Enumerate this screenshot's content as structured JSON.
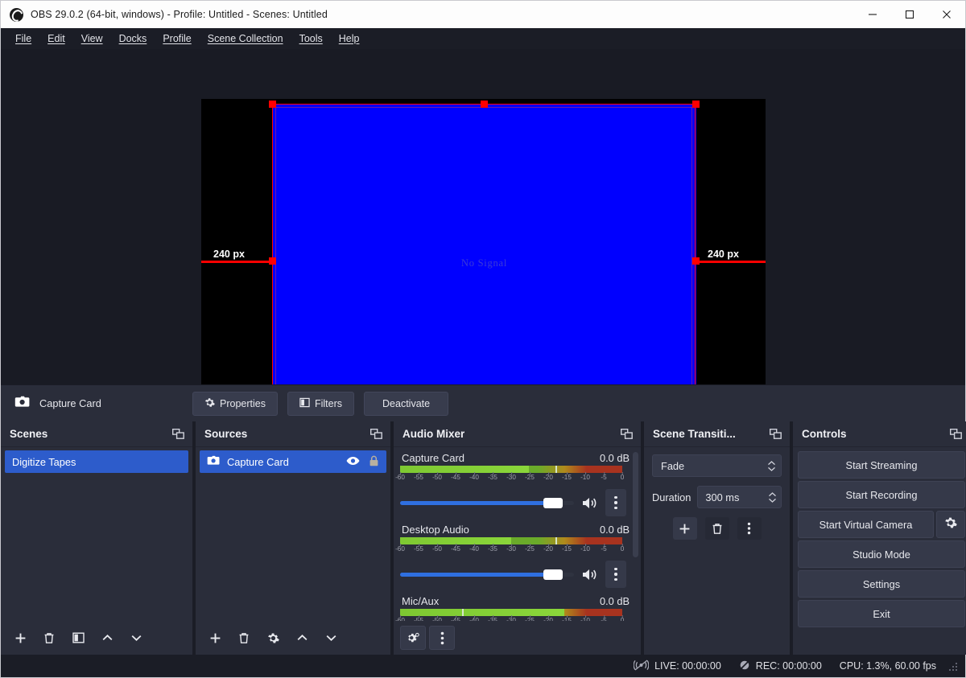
{
  "window": {
    "title": "OBS 29.0.2 (64-bit, windows) - Profile: Untitled - Scenes: Untitled",
    "logo_icon": "obs-logo-icon",
    "minimize_icon": "minimize-icon",
    "maximize_icon": "maximize-icon",
    "close_icon": "close-icon"
  },
  "menubar": {
    "items": [
      {
        "label": "File",
        "mnemonic": "F"
      },
      {
        "label": "Edit",
        "mnemonic": "E"
      },
      {
        "label": "View",
        "mnemonic": "V"
      },
      {
        "label": "Docks",
        "mnemonic": "D"
      },
      {
        "label": "Profile",
        "mnemonic": "P"
      },
      {
        "label": "Scene Collection",
        "mnemonic": "S"
      },
      {
        "label": "Tools",
        "mnemonic": "T"
      },
      {
        "label": "Help",
        "mnemonic": "H"
      }
    ]
  },
  "preview": {
    "no_signal_text": "No Signal",
    "guide_left_label": "240 px",
    "guide_right_label": "240 px",
    "selection_color": "#ff0000",
    "source_color": "#0000ff",
    "canvas_color": "#000000"
  },
  "source_toolbar": {
    "source_icon": "camera-icon",
    "source_name": "Capture Card",
    "properties_label": "Properties",
    "properties_icon": "gear-icon",
    "filters_label": "Filters",
    "filters_icon": "filters-icon",
    "deactivate_label": "Deactivate"
  },
  "scenes": {
    "title": "Scenes",
    "popout_icon": "popout-icon",
    "items": [
      {
        "label": "Digitize Tapes",
        "selected": true
      }
    ],
    "toolbar": [
      {
        "name": "add-scene-button",
        "icon": "plus-icon"
      },
      {
        "name": "remove-scene-button",
        "icon": "trash-icon"
      },
      {
        "name": "scene-filters-button",
        "icon": "filters-icon"
      },
      {
        "name": "move-scene-up-button",
        "icon": "chevron-up-icon"
      },
      {
        "name": "move-scene-down-button",
        "icon": "chevron-down-icon"
      }
    ]
  },
  "sources": {
    "title": "Sources",
    "popout_icon": "popout-icon",
    "items": [
      {
        "label": "Capture Card",
        "selected": true,
        "icon": "camera-icon",
        "visible_icon": "eye-icon",
        "lock_icon": "lock-icon"
      }
    ],
    "toolbar": [
      {
        "name": "add-source-button",
        "icon": "plus-icon"
      },
      {
        "name": "remove-source-button",
        "icon": "trash-icon"
      },
      {
        "name": "source-properties-button",
        "icon": "gear-icon"
      },
      {
        "name": "move-source-up-button",
        "icon": "chevron-up-icon"
      },
      {
        "name": "move-source-down-button",
        "icon": "chevron-down-icon"
      }
    ]
  },
  "audio_mixer": {
    "title": "Audio Mixer",
    "popout_icon": "popout-icon",
    "scale_ticks": [
      "-60",
      "-55",
      "-50",
      "-45",
      "-40",
      "-35",
      "-30",
      "-25",
      "-20",
      "-15",
      "-10",
      "-5",
      "0"
    ],
    "channels": [
      {
        "name": "Capture Card",
        "db": "0.0 dB",
        "level_pct": 58,
        "peak_pct": 70,
        "volume_pct": 88,
        "speaker_icon": "speaker-icon",
        "menu_icon": "kebab-menu-icon"
      },
      {
        "name": "Desktop Audio",
        "db": "0.0 dB",
        "level_pct": 50,
        "peak_pct": 70,
        "volume_pct": 88,
        "speaker_icon": "speaker-icon",
        "menu_icon": "kebab-menu-icon"
      },
      {
        "name": "Mic/Aux",
        "db": "0.0 dB",
        "level_pct": 74,
        "peak_pct": 28,
        "volume_pct": 88,
        "speaker_icon": "speaker-icon",
        "menu_icon": "kebab-menu-icon"
      }
    ],
    "toolbar": [
      {
        "name": "advanced-audio-properties-button",
        "icon": "gear-advanced-icon"
      },
      {
        "name": "audio-mixer-menu-button",
        "icon": "kebab-menu-icon"
      }
    ]
  },
  "scene_transitions": {
    "title": "Scene Transiti...",
    "popout_icon": "popout-icon",
    "transition_value": "Fade",
    "duration_label": "Duration",
    "duration_value": "300 ms",
    "buttons": [
      {
        "name": "add-transition-button",
        "icon": "plus-icon"
      },
      {
        "name": "remove-transition-button",
        "icon": "trash-icon"
      },
      {
        "name": "transition-menu-button",
        "icon": "kebab-menu-icon"
      }
    ]
  },
  "controls": {
    "title": "Controls",
    "popout_icon": "popout-icon",
    "start_streaming_label": "Start Streaming",
    "start_recording_label": "Start Recording",
    "start_virtual_camera_label": "Start Virtual Camera",
    "virtual_camera_config_icon": "gear-icon",
    "studio_mode_label": "Studio Mode",
    "settings_label": "Settings",
    "exit_label": "Exit"
  },
  "statusbar": {
    "live_icon": "broadcast-off-icon",
    "live_text": "LIVE: 00:00:00",
    "rec_icon": "record-off-icon",
    "rec_text": "REC: 00:00:00",
    "cpu_text": "CPU: 1.3%, 60.00 fps",
    "resize_grip_icon": "resize-grip-icon"
  }
}
